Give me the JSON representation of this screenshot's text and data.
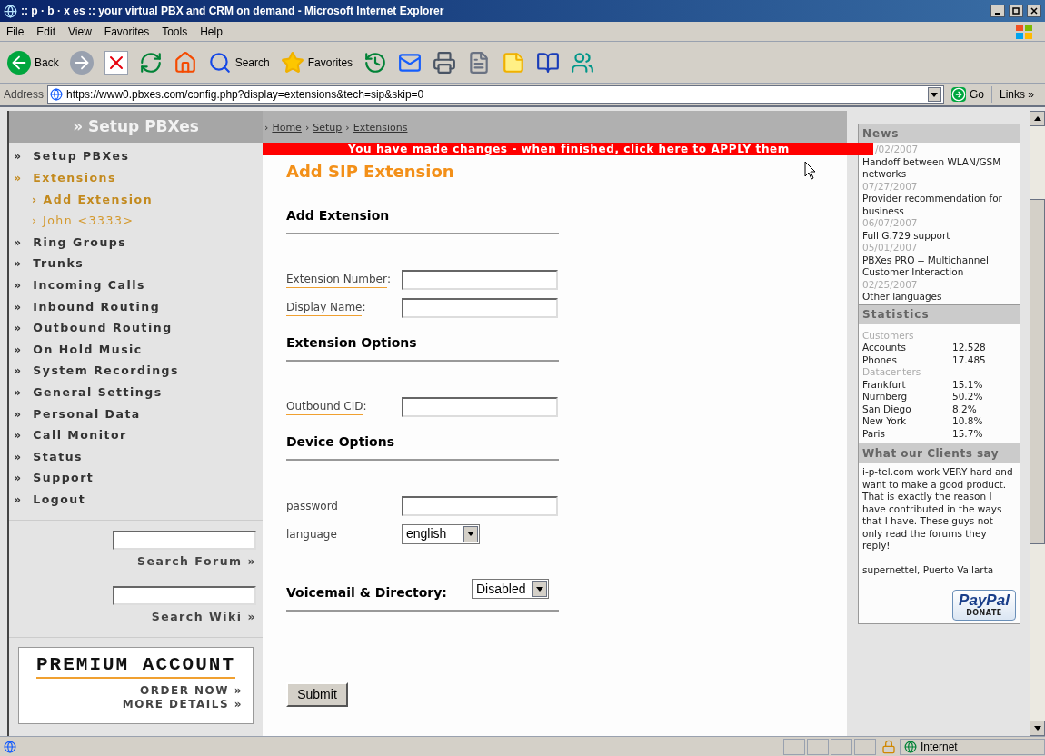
{
  "window": {
    "title": ":: p · b · x es :: your virtual PBX and CRM on demand - Microsoft Internet Explorer"
  },
  "menu": [
    "File",
    "Edit",
    "View",
    "Favorites",
    "Tools",
    "Help"
  ],
  "toolbar": [
    {
      "kind": "back",
      "label": "Back"
    },
    {
      "kind": "forward"
    },
    {
      "kind": "stop"
    },
    {
      "kind": "refresh"
    },
    {
      "kind": "home"
    },
    {
      "kind": "search",
      "label": "Search"
    },
    {
      "kind": "favorites",
      "label": "Favorites"
    },
    {
      "kind": "history"
    },
    {
      "kind": "mail"
    },
    {
      "kind": "print"
    },
    {
      "kind": "edit"
    },
    {
      "kind": "note"
    },
    {
      "kind": "research"
    },
    {
      "kind": "messenger"
    }
  ],
  "address": {
    "label": "Address",
    "value": "https://www0.pbxes.com/config.php?display=extensions&tech=sip&skip=0",
    "go": "Go",
    "links": "Links »"
  },
  "sidebar": {
    "heading": "» Setup PBXes",
    "bullet": "»",
    "sub_bullet": "›",
    "items": [
      {
        "label": "Setup PBXes",
        "selected": false
      },
      {
        "label": "Extensions",
        "selected": true,
        "children": [
          {
            "label": "Add Extension",
            "selected": true
          },
          {
            "label": "John <3333>",
            "selected": false
          }
        ]
      },
      {
        "label": "Ring Groups",
        "selected": false
      },
      {
        "label": "Trunks",
        "selected": false
      },
      {
        "label": "Incoming Calls",
        "selected": false
      },
      {
        "label": "Inbound Routing",
        "selected": false
      },
      {
        "label": "Outbound Routing",
        "selected": false
      },
      {
        "label": "On Hold Music",
        "selected": false
      },
      {
        "label": "System Recordings",
        "selected": false
      },
      {
        "label": "General Settings",
        "selected": false
      },
      {
        "label": "Personal Data",
        "selected": false
      },
      {
        "label": "Call Monitor",
        "selected": false
      },
      {
        "label": "Status",
        "selected": false
      },
      {
        "label": "Support",
        "selected": false
      },
      {
        "label": "Logout",
        "selected": false
      }
    ],
    "searches": [
      "Search Forum »",
      "Search Wiki »"
    ],
    "premium": {
      "title": "PREMIUM ACCOUNT",
      "links": [
        "ORDER NOW »",
        "MORE DETAILS »"
      ]
    }
  },
  "breadcrumb": [
    "Home",
    "Setup",
    "Extensions"
  ],
  "breadcrumb_separator": "›",
  "label_colon": ":",
  "banner": "You have made changes - when finished, click here to APPLY them",
  "page_title": "Add SIP Extension",
  "sections": [
    {
      "title": "Add Extension",
      "fields": [
        {
          "kind": "text",
          "label": "Extension Number",
          "linked": true
        },
        {
          "kind": "text",
          "label": "Display Name",
          "linked": true
        }
      ]
    },
    {
      "title": "Extension Options",
      "fields": [
        {
          "kind": "text",
          "label": "Outbound CID",
          "linked": true
        }
      ]
    },
    {
      "title": "Device Options",
      "fields": [
        {
          "kind": "text",
          "label": "password",
          "linked": false
        },
        {
          "kind": "select",
          "label": "language",
          "linked": false,
          "value": "english"
        }
      ]
    }
  ],
  "voicemail": {
    "label": "Voicemail & Directory:",
    "value": "Disabled"
  },
  "submit": "Submit",
  "news": {
    "title": "News",
    "items": [
      {
        "date": "/02/2007",
        "text": "Handoff between WLAN/GSM networks"
      },
      {
        "date": "07/27/2007",
        "text": "Provider recommendation for business"
      },
      {
        "date": "06/07/2007",
        "text": "Full G.729 support"
      },
      {
        "date": "05/01/2007",
        "text": "PBXes PRO -- Multichannel Customer Interaction"
      },
      {
        "date": "02/25/2007",
        "text": "Other languages"
      }
    ]
  },
  "statistics": {
    "title": "Statistics",
    "groups": [
      {
        "name": "Customers",
        "rows": [
          {
            "label": "Accounts",
            "value": "12.528"
          },
          {
            "label": "Phones",
            "value": "17.485"
          }
        ]
      },
      {
        "name": "Datacenters",
        "rows": [
          {
            "label": "Frankfurt",
            "value": "15.1%"
          },
          {
            "label": "Nürnberg",
            "value": "50.2%"
          },
          {
            "label": "San Diego",
            "value": "8.2%"
          },
          {
            "label": "New York",
            "value": "10.8%"
          },
          {
            "label": "Paris",
            "value": "15.7%"
          }
        ]
      }
    ]
  },
  "testimonial": {
    "title": "What our Clients say",
    "quote": "i-p-tel.com work VERY hard and want to make a good product. That is exactly the reason I have contributed in the ways that I have. These guys not only read the forums they reply!",
    "author": "supernettel, Puerto Vallarta"
  },
  "paypal": {
    "brand": "PayPal",
    "action": "DONATE"
  },
  "status_bar": {
    "zone": "Internet"
  }
}
